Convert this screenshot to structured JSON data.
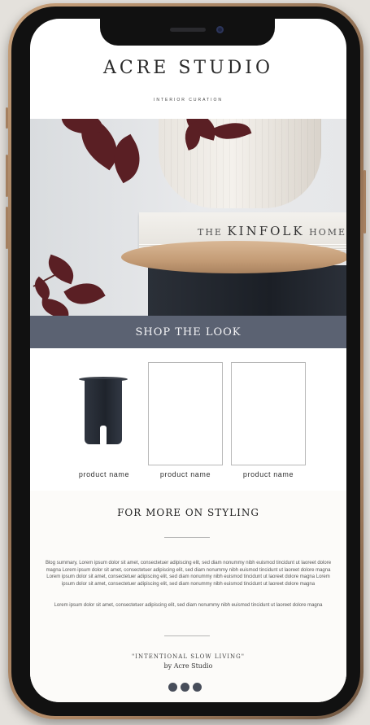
{
  "brand": {
    "name": "ACRE STUDIO",
    "tagline": "INTERIOR CURATION"
  },
  "hero": {
    "book_title_prefix": "THE",
    "book_title_main": "KINFOLK",
    "book_title_suffix": "HOME"
  },
  "shop_banner": {
    "label": "SHOP THE LOOK"
  },
  "products": [
    {
      "name": "product name",
      "has_image": true
    },
    {
      "name": "product name",
      "has_image": false
    },
    {
      "name": "product name",
      "has_image": false
    }
  ],
  "styling": {
    "title": "FOR MORE ON STYLING",
    "paragraph1": "Blog summary, Lorem ipsum dolor sit amet, consectetuer adipiscing elit, sed diam nonummy nibh euismod tincidunt ut laoreet dolore magna Lorem ipsum dolor sit amet, consectetuer adipiscing elit, sed diam nonummy nibh euismod tincidunt ut laoreet dolore magna Lorem ipsum dolor sit amet, consectetuer adipiscing elit, sed diam nonummy nibh euismod tincidunt ut laoreet dolore magna Lorem ipsum dolor sit amet, consectetuer adipiscing elit, sed diam nonummy nibh euismod tincidunt ut laoreet dolore magna",
    "paragraph2": "Lorem ipsum dolor sit amet, consectetuer adipiscing elit, sed diam nonummy nibh euismod tincidunt ut laoreet dolore magna"
  },
  "footer": {
    "quote": "\"INTENTIONAL SLOW LIVING\"",
    "byline": "by Acre Studio",
    "dot_count": 3
  },
  "colors": {
    "accent": "#5b6272",
    "dots": "#474d5a",
    "leaf": "#5a1f24",
    "frame": "#b48c69"
  }
}
